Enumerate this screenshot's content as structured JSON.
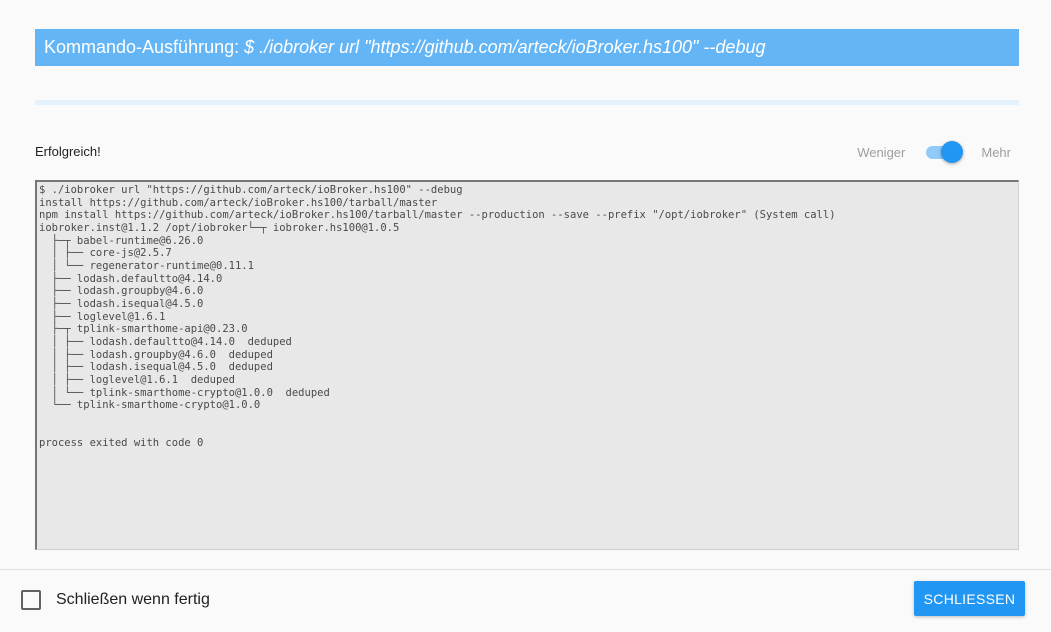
{
  "dialog": {
    "title_prefix": "Kommando-Ausführung: ",
    "title_command": "$ ./iobroker url \"https://github.com/arteck/ioBroker.hs100\" --debug"
  },
  "progress": {
    "value_percent": 100
  },
  "status": {
    "text": "Erfolgreich!"
  },
  "toggle": {
    "less_label": "Weniger",
    "more_label": "Mehr",
    "state": "Mehr"
  },
  "log": {
    "lines": [
      "$ ./iobroker url \"https://github.com/arteck/ioBroker.hs100\" --debug",
      "install https://github.com/arteck/ioBroker.hs100/tarball/master",
      "npm install https://github.com/arteck/ioBroker.hs100/tarball/master --production --save --prefix \"/opt/iobroker\" (System call)",
      "iobroker.inst@1.1.2 /opt/iobroker└─┬ iobroker.hs100@1.0.5",
      "  ├─┬ babel-runtime@6.26.0",
      "  │ ├── core-js@2.5.7",
      "  │ └── regenerator-runtime@0.11.1",
      "  ├── lodash.defaultto@4.14.0",
      "  ├── lodash.groupby@4.6.0",
      "  ├── lodash.isequal@4.5.0",
      "  ├── loglevel@1.6.1",
      "  ├─┬ tplink-smarthome-api@0.23.0",
      "  │ ├── lodash.defaultto@4.14.0  deduped",
      "  │ ├── lodash.groupby@4.6.0  deduped",
      "  │ ├── lodash.isequal@4.5.0  deduped",
      "  │ ├── loglevel@1.6.1  deduped",
      "  │ └── tplink-smarthome-crypto@1.0.0  deduped",
      "  └── tplink-smarthome-crypto@1.0.0",
      "",
      "",
      "process exited with code 0"
    ]
  },
  "footer": {
    "checkbox_label": "Schließen wenn fertig",
    "checkbox_checked": false,
    "close_button_label": "SCHLIESSEN"
  }
}
